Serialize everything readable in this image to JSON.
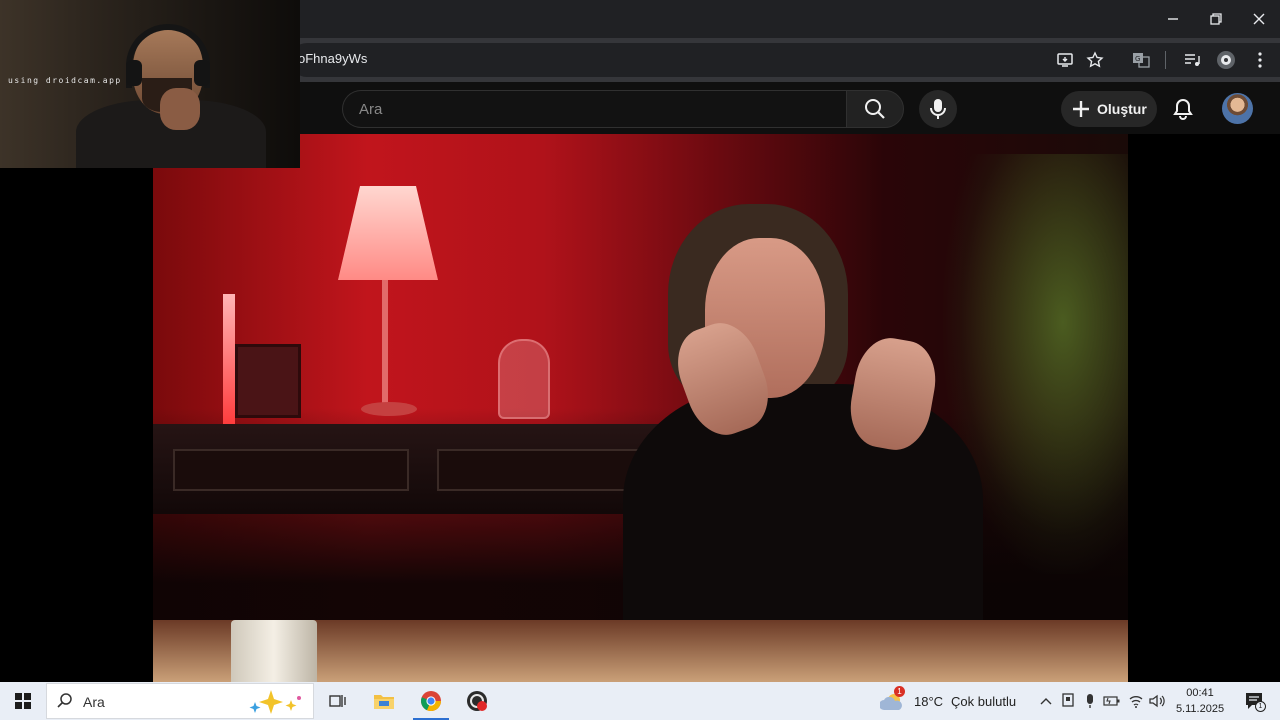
{
  "browser": {
    "url_fragment": "oFhna9yWs",
    "controls": [
      "minimize-icon",
      "restore-icon",
      "close-icon"
    ],
    "toolbar_icons": [
      "install-app-icon",
      "bookmark-star-icon",
      "translate-icon",
      "media-queue-icon",
      "extensions-icon",
      "more-menu-icon"
    ]
  },
  "youtube": {
    "search": {
      "placeholder": "Ara"
    },
    "create_label": "Oluştur",
    "icons": [
      "search-icon",
      "mic-icon",
      "plus-icon",
      "bell-icon"
    ]
  },
  "webcam": {
    "watermark": "using droidcam.app"
  },
  "taskbar": {
    "search_label": "Ara",
    "apps": [
      "task-view-icon",
      "file-explorer-icon",
      "chrome-icon",
      "obs-icon"
    ],
    "weather": {
      "temperature": "18°C",
      "condition": "Çok bulutlu",
      "badge": "1"
    },
    "tray_icons": [
      "chevron-up-icon",
      "display-icon",
      "mic-icon",
      "battery-icon",
      "wifi-icon",
      "speaker-icon"
    ],
    "clock": {
      "time": "00:41",
      "date": "5.11.2025"
    },
    "notification_count": "1"
  },
  "colors": {
    "browser_titlebar": "#202124",
    "browser_toolbar": "#35363a",
    "yt_header": "#0f0f0f",
    "taskbar": "#e9eef6",
    "accent": "#2c6fd1"
  }
}
